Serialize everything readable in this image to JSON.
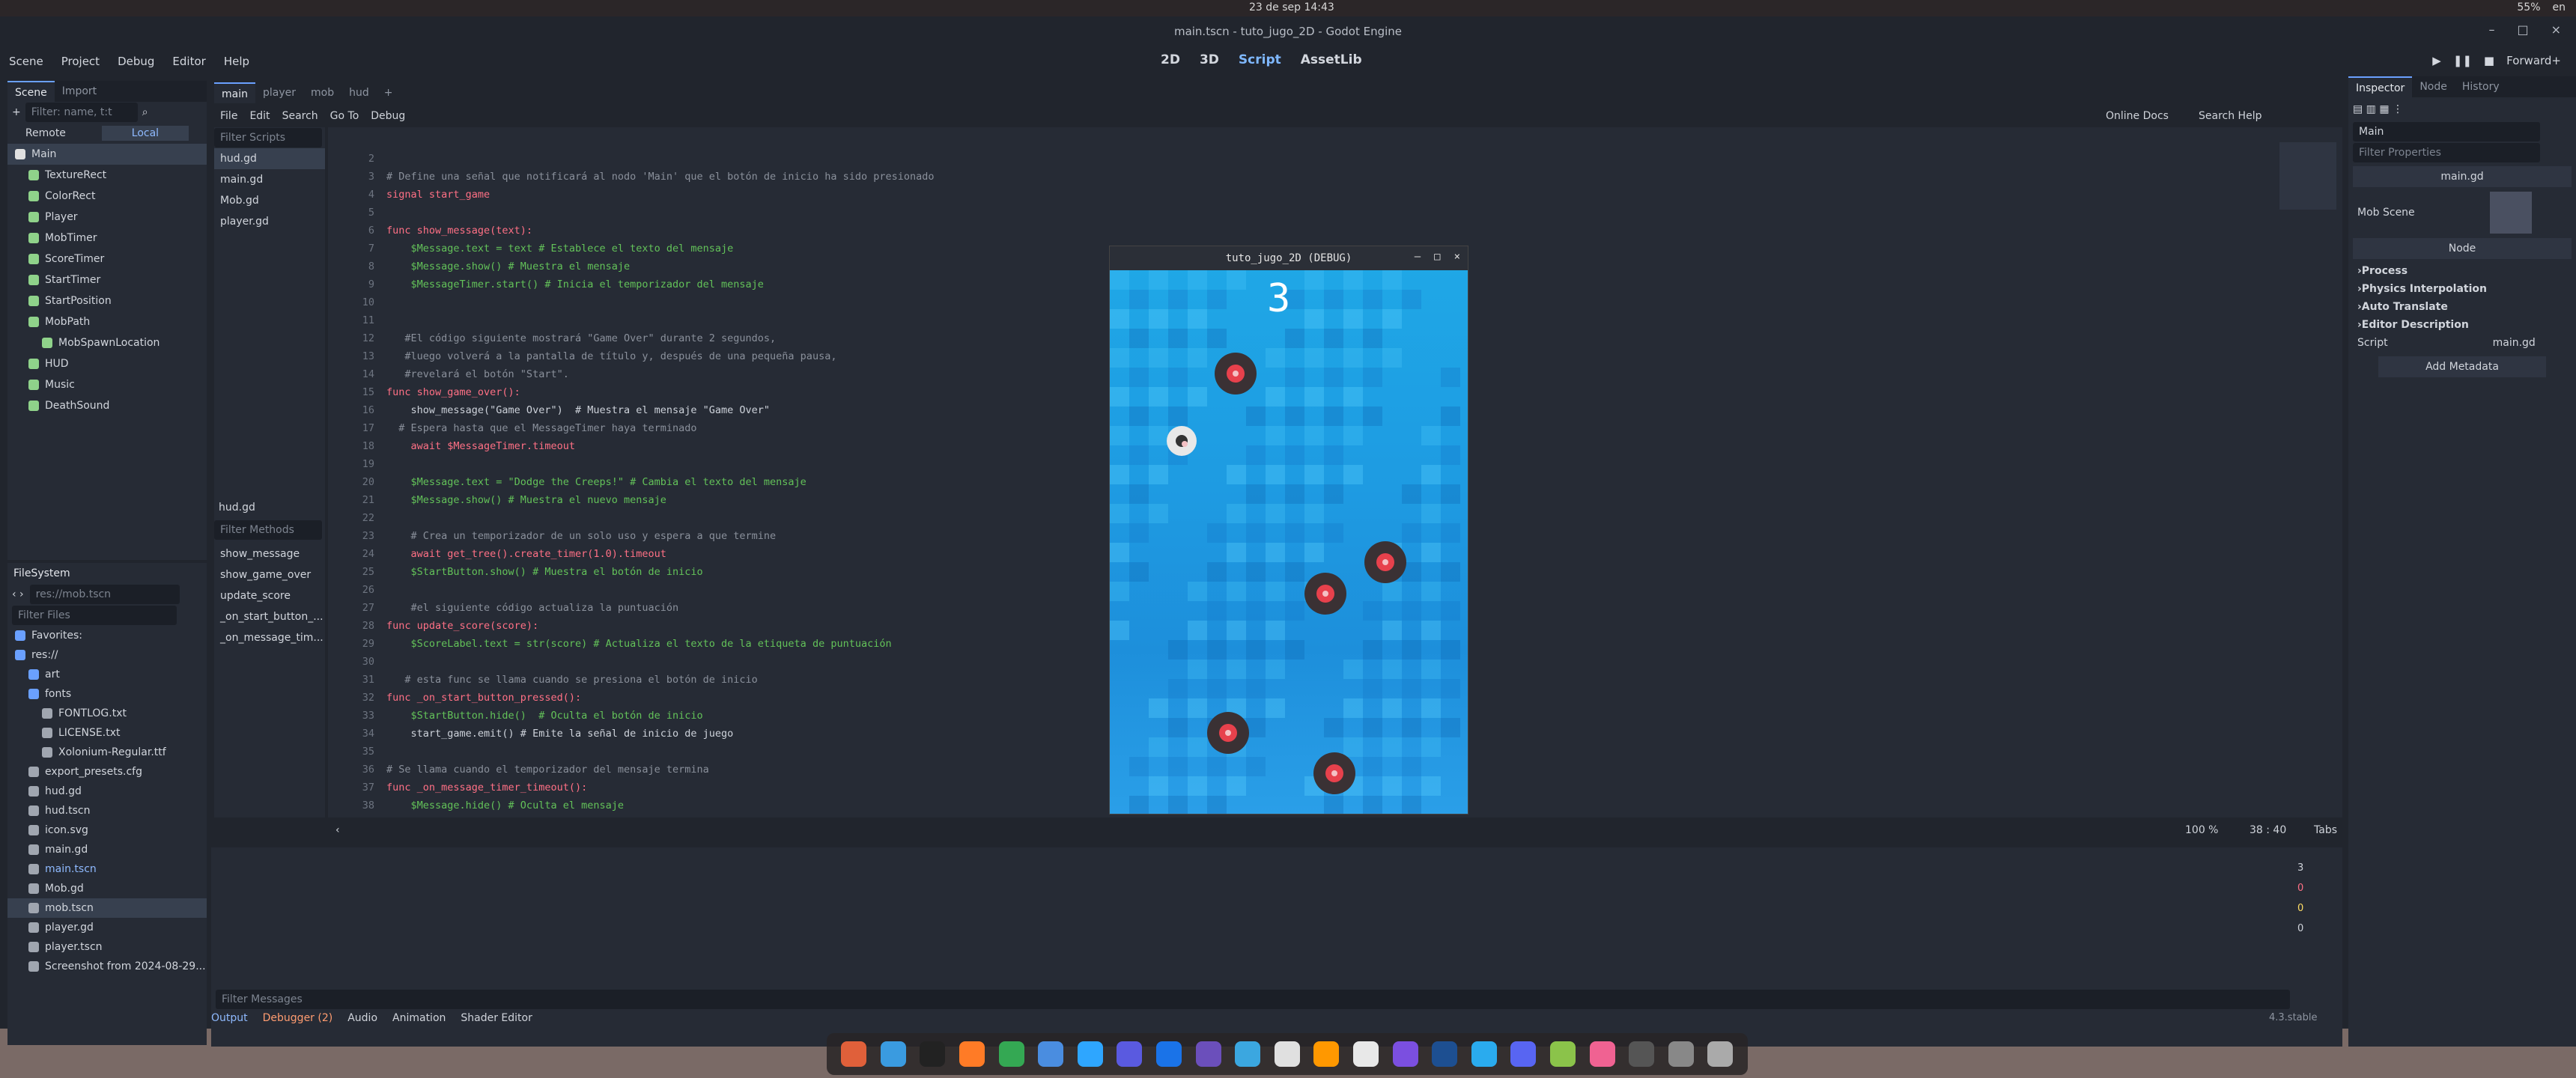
{
  "os": {
    "clock": "23 de sep  14:43",
    "tray": [
      "55%",
      "en"
    ]
  },
  "window": {
    "title": "main.tscn - tuto_jugo_2D - Godot Engine",
    "controls": [
      "–",
      "□",
      "×"
    ]
  },
  "menu": [
    "Scene",
    "Project",
    "Debug",
    "Editor",
    "Help"
  ],
  "workspaces": [
    "2D",
    "3D",
    "Script",
    "AssetLib"
  ],
  "renderer": "Forward+",
  "scene_dock": {
    "tabs": [
      "Scene",
      "Import"
    ],
    "filter_placeholder": "Filter: name, t:t",
    "remote": "Remote",
    "local": "Local",
    "nodes": [
      {
        "name": "Main",
        "indent": 0
      },
      {
        "name": "TextureRect",
        "indent": 1
      },
      {
        "name": "ColorRect",
        "indent": 1
      },
      {
        "name": "Player",
        "indent": 1
      },
      {
        "name": "MobTimer",
        "indent": 1
      },
      {
        "name": "ScoreTimer",
        "indent": 1
      },
      {
        "name": "StartTimer",
        "indent": 1
      },
      {
        "name": "StartPosition",
        "indent": 1
      },
      {
        "name": "MobPath",
        "indent": 1
      },
      {
        "name": "MobSpawnLocation",
        "indent": 2
      },
      {
        "name": "HUD",
        "indent": 1
      },
      {
        "name": "Music",
        "indent": 1
      },
      {
        "name": "DeathSound",
        "indent": 1
      }
    ]
  },
  "filesystem": {
    "title": "FileSystem",
    "path": "res://mob.tscn",
    "filter_placeholder": "Filter Files",
    "items": [
      {
        "name": "Favorites:",
        "indent": 0
      },
      {
        "name": "res://",
        "indent": 0
      },
      {
        "name": "art",
        "indent": 1
      },
      {
        "name": "fonts",
        "indent": 1
      },
      {
        "name": "FONTLOG.txt",
        "indent": 2
      },
      {
        "name": "LICENSE.txt",
        "indent": 2
      },
      {
        "name": "Xolonium-Regular.ttf",
        "indent": 2
      },
      {
        "name": "export_presets.cfg",
        "indent": 1
      },
      {
        "name": "hud.gd",
        "indent": 1
      },
      {
        "name": "hud.tscn",
        "indent": 1
      },
      {
        "name": "icon.svg",
        "indent": 1
      },
      {
        "name": "main.gd",
        "indent": 1
      },
      {
        "name": "main.tscn",
        "indent": 1
      },
      {
        "name": "Mob.gd",
        "indent": 1
      },
      {
        "name": "mob.tscn",
        "indent": 1
      },
      {
        "name": "player.gd",
        "indent": 1
      },
      {
        "name": "player.tscn",
        "indent": 1
      },
      {
        "name": "Screenshot from 2024-08-29...",
        "indent": 1
      }
    ]
  },
  "scene_tabs": [
    "main",
    "player",
    "mob",
    "hud"
  ],
  "script_menu": [
    "File",
    "Edit",
    "Search",
    "Go To",
    "Debug"
  ],
  "script_tools": [
    "Online Docs",
    "Search Help"
  ],
  "scripts_panel": {
    "filter_placeholder": "Filter Scripts",
    "scripts": [
      "hud.gd",
      "main.gd",
      "Mob.gd",
      "player.gd"
    ],
    "current": "hud.gd",
    "methods_placeholder": "Filter Methods",
    "methods": [
      "show_message",
      "show_game_over",
      "update_score",
      "_on_start_button_...",
      "_on_message_tim..."
    ]
  },
  "code": [
    {
      "n": "2",
      "t": ""
    },
    {
      "n": "3",
      "t": "# Define una señal que notificará al nodo 'Main' que el botón de inicio ha sido presionado"
    },
    {
      "n": "4",
      "t": "signal start_game"
    },
    {
      "n": "5",
      "t": ""
    },
    {
      "n": "6",
      "t": "func show_message(text):"
    },
    {
      "n": "7",
      "t": "    $Message.text = text # Establece el texto del mensaje"
    },
    {
      "n": "8",
      "t": "    $Message.show() # Muestra el mensaje"
    },
    {
      "n": "9",
      "t": "    $MessageTimer.start() # Inicia el temporizador del mensaje"
    },
    {
      "n": "10",
      "t": ""
    },
    {
      "n": "11",
      "t": ""
    },
    {
      "n": "12",
      "t": "   #El código siguiente mostrará \"Game Over\" durante 2 segundos,"
    },
    {
      "n": "13",
      "t": "   #luego volverá a la pantalla de título y, después de una pequeña pausa,"
    },
    {
      "n": "14",
      "t": "   #revelará el botón \"Start\"."
    },
    {
      "n": "15",
      "t": "func show_game_over():"
    },
    {
      "n": "16",
      "t": "    show_message(\"Game Over\")  # Muestra el mensaje \"Game Over\""
    },
    {
      "n": "17",
      "t": "  # Espera hasta que el MessageTimer haya terminado"
    },
    {
      "n": "18",
      "t": "    await $MessageTimer.timeout"
    },
    {
      "n": "19",
      "t": ""
    },
    {
      "n": "20",
      "t": "    $Message.text = \"Dodge the Creeps!\" # Cambia el texto del mensaje"
    },
    {
      "n": "21",
      "t": "    $Message.show() # Muestra el nuevo mensaje"
    },
    {
      "n": "22",
      "t": ""
    },
    {
      "n": "23",
      "t": "    # Crea un temporizador de un solo uso y espera a que termine"
    },
    {
      "n": "24",
      "t": "    await get_tree().create_timer(1.0).timeout"
    },
    {
      "n": "25",
      "t": "    $StartButton.show() # Muestra el botón de inicio"
    },
    {
      "n": "26",
      "t": ""
    },
    {
      "n": "27",
      "t": "    #el siguiente código actualiza la puntuación"
    },
    {
      "n": "28",
      "t": "func update_score(score):"
    },
    {
      "n": "29",
      "t": "    $ScoreLabel.text = str(score) # Actualiza el texto de la etiqueta de puntuación"
    },
    {
      "n": "30",
      "t": ""
    },
    {
      "n": "31",
      "t": "   # esta func se llama cuando se presiona el botón de inicio"
    },
    {
      "n": "32",
      "t": "func _on_start_button_pressed():"
    },
    {
      "n": "33",
      "t": "    $StartButton.hide()  # Oculta el botón de inicio"
    },
    {
      "n": "34",
      "t": "    start_game.emit() # Emite la señal de inicio de juego"
    },
    {
      "n": "35",
      "t": ""
    },
    {
      "n": "36",
      "t": "# Se llama cuando el temporizador del mensaje termina"
    },
    {
      "n": "37",
      "t": "func _on_message_timer_timeout():"
    },
    {
      "n": "38",
      "t": "    $Message.hide() # Oculta el mensaje"
    }
  ],
  "editor_status": {
    "zoom": "100 %",
    "position": "38 :  40",
    "indent": "Tabs"
  },
  "game_window": {
    "title": "tuto_jugo_2D (DEBUG)",
    "score": "3"
  },
  "bottom_panel": {
    "filter_placeholder": "Filter Messages",
    "tabs": [
      "Output",
      "Debugger (2)",
      "Audio",
      "Animation",
      "Shader Editor"
    ],
    "version": "4.3.stable",
    "counts": [
      "3",
      "0",
      "0",
      "0"
    ]
  },
  "inspector": {
    "tabs": [
      "Inspector",
      "Node",
      "History"
    ],
    "node": "Main",
    "filter_placeholder": "Filter Properties",
    "script_title": "main.gd",
    "mob_scene_label": "Mob Scene",
    "section": "Node",
    "groups": [
      "Process",
      "Physics Interpolation",
      "Auto Translate",
      "Editor Description"
    ],
    "script_label": "Script",
    "script_value": "main.gd",
    "add_metadata": "Add Metadata"
  }
}
